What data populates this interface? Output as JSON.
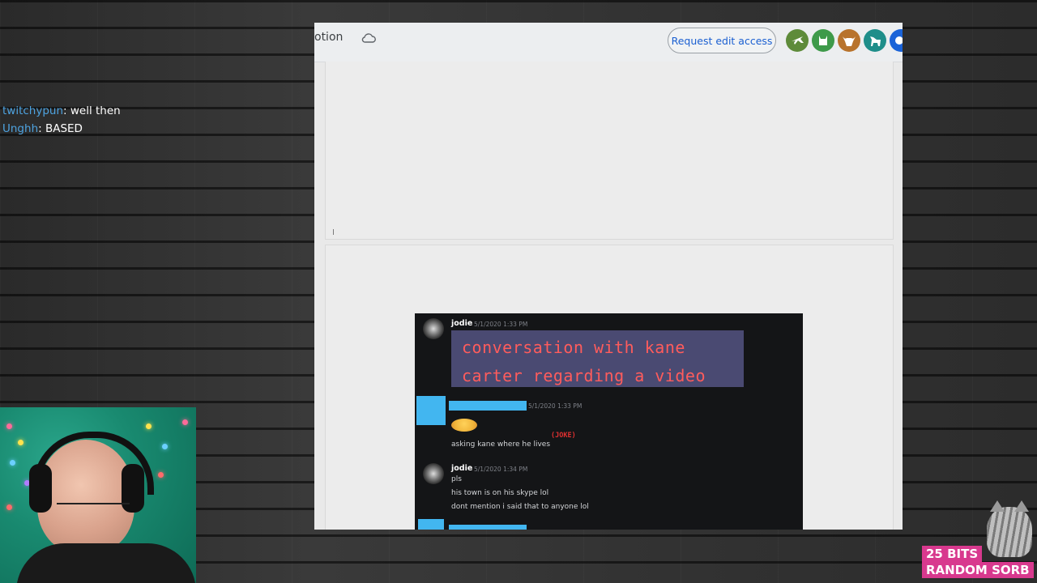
{
  "chat": {
    "messages": [
      {
        "user": "twitchypun",
        "text": ": well then"
      },
      {
        "user": "Unghh",
        "text": ": BASED"
      }
    ]
  },
  "doc": {
    "title_partial": "otion",
    "request_edit_label": "Request edit access",
    "avatar_icons": [
      "plane-avatar-icon",
      "cat-avatar-icon",
      "bull-avatar-icon",
      "dog-avatar-icon",
      "animal-avatar-icon"
    ],
    "avatar_colors": [
      "#5e8b3a",
      "#3e9a4a",
      "#b8732c",
      "#1e8e8a",
      "#1a63d8"
    ]
  },
  "discord": {
    "msg1": {
      "user": "jodie",
      "time": "5/1/2020 1:33 PM",
      "banner": "conversation with kane carter regarding a video"
    },
    "msg2": {
      "time": "5/1/2020 1:33 PM",
      "text": "asking kane where he lives",
      "joke": "(JOKE)"
    },
    "msg3": {
      "user": "jodie",
      "time": "5/1/2020 1:34 PM",
      "lines": [
        "pls",
        "his town is on his skype lol",
        "dont mention i said that to anyone lol"
      ]
    },
    "accent_color": "#42b6f0"
  },
  "alert": {
    "line1": "25 BITS",
    "line2": "RANDOM SORB"
  }
}
